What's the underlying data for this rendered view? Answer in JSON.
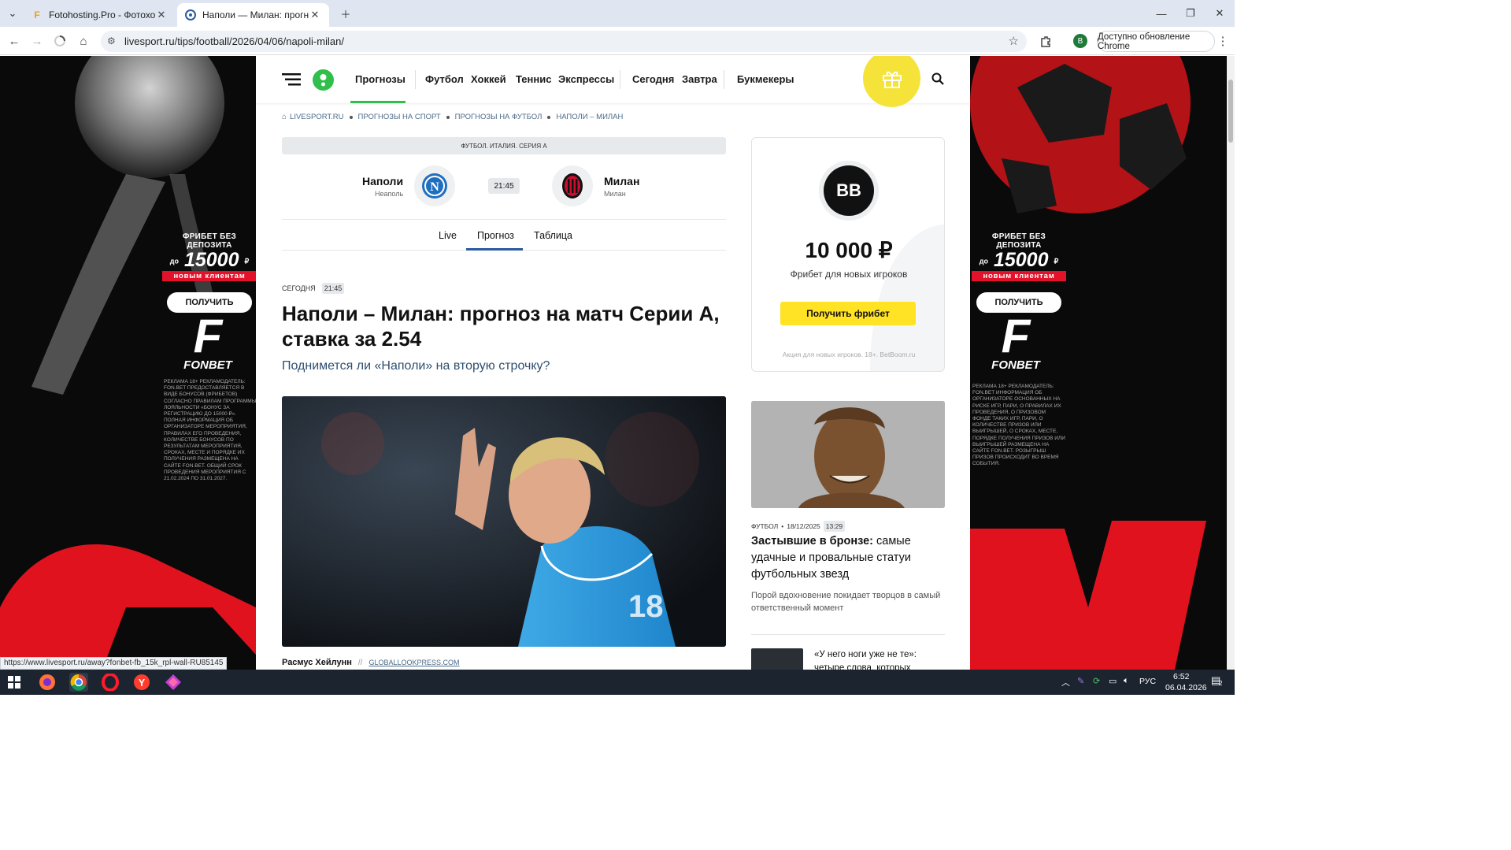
{
  "browser": {
    "tabs": [
      {
        "title": "Fotohosting.Pro - Фотохостинг",
        "active": false,
        "favicon": "fotohosting-icon"
      },
      {
        "title": "Наполи — Милан: прогноз, ст",
        "active": true,
        "favicon": "livesport-icon"
      }
    ],
    "url": "livesport.ru/tips/football/2026/04/06/napoli-milan/",
    "profile_letter": "B",
    "update_label": "Доступно обновление Chrome",
    "status_url": "https://www.livesport.ru/away?fonbet-fb_15k_rpl-wall-RU85145"
  },
  "ads": {
    "left": {
      "promo_line1": "ФРИБЕТ БЕЗ ДЕПОЗИТА",
      "promo_prefix": "до",
      "promo_amount": "15000",
      "promo_currency": "₽",
      "promo_line3": "новым клиентам",
      "button": "ПОЛУЧИТЬ",
      "brand": "FONBET",
      "legal": "РЕКЛАМА 18+ РЕКЛАМОДАТЕЛЬ: FON.BET ПРЕДОСТАВЛЯЕТСЯ В ВИДЕ БОНУСОВ (ФРИБЕТОВ) СОГЛАСНО ПРАВИЛАМ ПРОГРАММЫ ЛОЯЛЬНОСТИ «БОНУС ЗА РЕГИСТРАЦИЮ ДО 15000 ₽». ПОЛНАЯ ИНФОРМАЦИЯ ОБ ОРГАНИЗАТОРЕ МЕРОПРИЯТИЯ, ПРАВИЛАХ ЕГО ПРОВЕДЕНИЯ, КОЛИЧЕСТВЕ БОНУСОВ ПО РЕЗУЛЬТАТАМ МЕРОПРИЯТИЯ, СРОКАХ, МЕСТЕ И ПОРЯДКЕ ИХ ПОЛУЧЕНИЯ РАЗМЕЩЕНА НА САЙТЕ FON.BET. ОБЩИЙ СРОК ПРОВЕДЕНИЯ МЕРОПРИЯТИЯ С 21.02.2024 ПО 31.01.2027."
    },
    "right": {
      "promo_line1": "ФРИБЕТ БЕЗ ДЕПОЗИТА",
      "promo_prefix": "до",
      "promo_amount": "15000",
      "promo_currency": "₽",
      "promo_line3": "новым клиентам",
      "button": "ПОЛУЧИТЬ",
      "brand": "FONBET",
      "legal": "РЕКЛАМА 18+ РЕКЛАМОДАТЕЛЬ: FON.BET ИНФОРМАЦИЯ ОБ ОРГАНИЗАТОРЕ ОСНОВАННЫХ НА РИСКЕ ИГР, ПАРИ, О ПРАВИЛАХ ИХ ПРОВЕДЕНИЯ, О ПРИЗОВОМ ФОНДЕ ТАКИХ ИГР, ПАРИ, О КОЛИЧЕСТВЕ ПРИЗОВ ИЛИ ВЫИГРЫШЕЙ, О СРОКАХ, МЕСТЕ, ПОРЯДКЕ ПОЛУЧЕНИЯ ПРИЗОВ ИЛИ ВЫИГРЫШЕЙ РАЗМЕЩЕНА НА САЙТЕ FON.BET. РОЗЫГРЫШ ПРИЗОВ ПРОИСХОДИТ ВО ВРЕМЯ СОБЫТИЯ."
    }
  },
  "nav": {
    "items": [
      "Прогнозы",
      "Футбол",
      "Хоккей",
      "Теннис",
      "Экспрессы",
      "Сегодня",
      "Завтра",
      "Букмекеры"
    ],
    "active": "Прогнозы",
    "accent": "#2fbf4a"
  },
  "breadcrumbs": [
    "LIVESPORT.RU",
    "ПРОГНОЗЫ НА СПОРТ",
    "ПРОГНОЗЫ НА ФУТБОЛ",
    "НАПОЛИ – МИЛАН"
  ],
  "match": {
    "league": "ФУТБОЛ. ИТАЛИЯ. СЕРИЯ А",
    "home": {
      "name": "Наполи",
      "city": "Неаполь"
    },
    "away": {
      "name": "Милан",
      "city": "Милан"
    },
    "time": "21:45",
    "tabs": [
      "Live",
      "Прогноз",
      "Таблица"
    ],
    "active_tab": "Прогноз"
  },
  "article": {
    "date_label": "СЕГОДНЯ",
    "time": "21:45",
    "title_bold": "Наполи – Милан:",
    "title_rest": " прогноз на матч Серии А, ставка за 2.54",
    "subtitle": "Поднимется ли «Наполи» на вторую строчку?",
    "photo_author": "Расмус Хейлунн",
    "photo_sep": "//",
    "photo_source": "GLOBALLOOKPRESS.COM"
  },
  "sidebar": {
    "brand_logo": "BB",
    "amount": "10 000 ₽",
    "amount_sub": "Фрибет для новых игроков",
    "button": "Получить фрибет",
    "disclaimer": "Акция для новых игроков. 18+. BetBoom.ru",
    "news1": {
      "category": "ФУТБОЛ",
      "date": "18/12/2025",
      "time": "13:29",
      "title_bold": "Застывшие в бронзе:",
      "title_rest": " самые удачные и провальные статуи футбольных звезд",
      "desc": "Порой вдохновение покидает творцов в самый ответственный момент"
    },
    "news2": {
      "title": "«У него ноги уже не те»: четыре слова, которых"
    }
  },
  "taskbar": {
    "lang": "РУС",
    "time": "6:52",
    "date": "06.04.2026",
    "notif_count": "2"
  }
}
